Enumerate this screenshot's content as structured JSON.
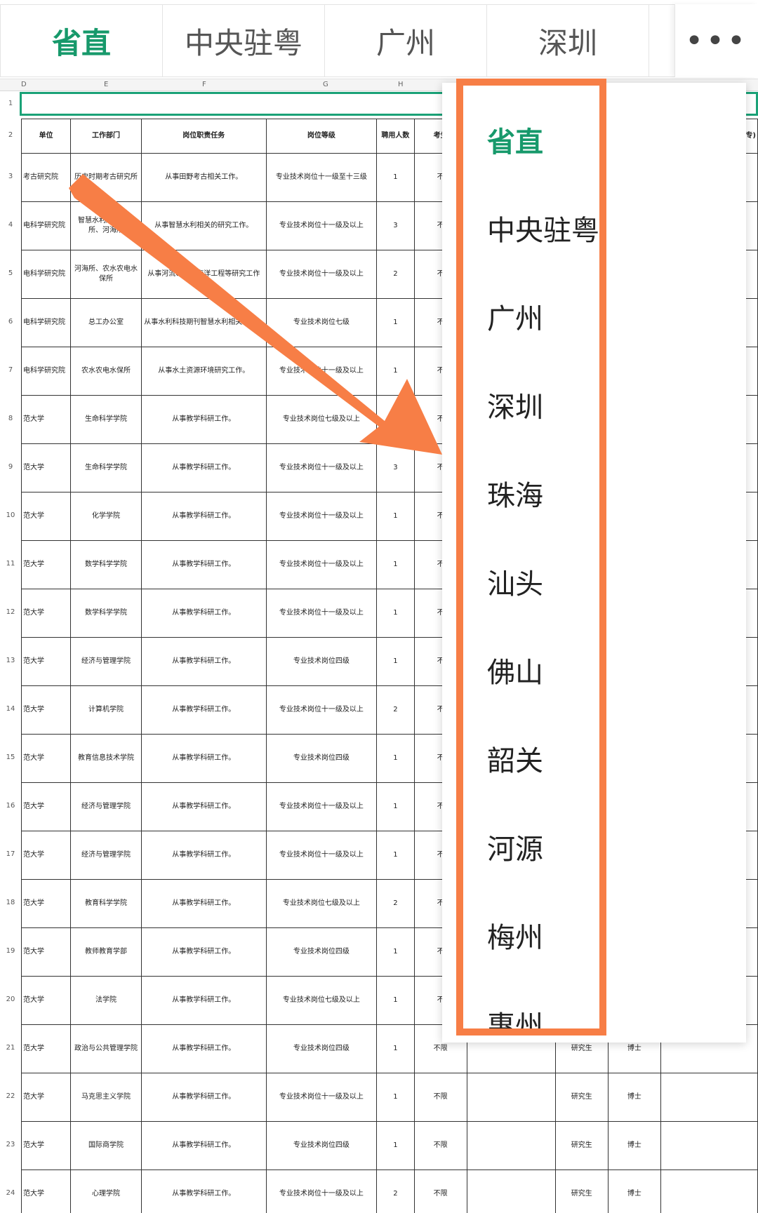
{
  "tabs": [
    {
      "label": "省直",
      "active": true
    },
    {
      "label": "中央驻粤",
      "active": false
    },
    {
      "label": "广州",
      "active": false
    },
    {
      "label": "深圳",
      "active": false
    }
  ],
  "more_label": "•••",
  "columns": [
    "D",
    "E",
    "F",
    "G",
    "H"
  ],
  "header_row": {
    "num": "2",
    "cells": [
      "单位",
      "工作部门",
      "岗位职责任务",
      "岗位等级",
      "聘用人数",
      "考生"
    ]
  },
  "row1_num": "1",
  "rows": [
    {
      "num": "3",
      "unit": "考古研究院",
      "dept": "历史时期考古研究所",
      "duty": "从事田野考古相关工作。",
      "level": "专业技术岗位十一级至十三级",
      "count": "1",
      "c6": "不",
      "c8": "",
      "c9": ""
    },
    {
      "num": "4",
      "unit": "电科学研究院",
      "dept": "智慧水利所、河海所、河海所",
      "duty": "从事智慧水利相关的研究工作。",
      "level": "专业技术岗位十一级及以上",
      "count": "3",
      "c6": "不",
      "c8": "",
      "c9": ""
    },
    {
      "num": "5",
      "unit": "电科学研究院",
      "dept": "河海所、农水农电水保所",
      "duty": "从事河流、近岸海洋工程等研究工作",
      "level": "专业技术岗位十一级及以上",
      "count": "2",
      "c6": "不",
      "c8": "",
      "c9": ""
    },
    {
      "num": "6",
      "unit": "电科学研究院",
      "dept": "总工办公室",
      "duty": "从事水利科技期刊智慧水利相关工作。",
      "level": "专业技术岗位七级",
      "count": "1",
      "c6": "不",
      "c8": "",
      "c9": ""
    },
    {
      "num": "7",
      "unit": "电科学研究院",
      "dept": "农水农电水保所",
      "duty": "从事水土资源环境研究工作。",
      "level": "专业技术岗位十一级及以上",
      "count": "1",
      "c6": "不",
      "c8": "",
      "c9": ""
    },
    {
      "num": "8",
      "unit": "范大学",
      "dept": "生命科学学院",
      "duty": "从事教学科研工作。",
      "level": "专业技术岗位七级及以上",
      "count": "",
      "c6": "不",
      "c8": "",
      "c9": ""
    },
    {
      "num": "9",
      "unit": "范大学",
      "dept": "生命科学学院",
      "duty": "从事教学科研工作。",
      "level": "专业技术岗位十一级及以上",
      "count": "3",
      "c6": "不",
      "c8": "",
      "c9": ""
    },
    {
      "num": "10",
      "unit": "范大学",
      "dept": "化学学院",
      "duty": "从事教学科研工作。",
      "level": "专业技术岗位十一级及以上",
      "count": "1",
      "c6": "不",
      "c8": "",
      "c9": ""
    },
    {
      "num": "11",
      "unit": "范大学",
      "dept": "数学科学学院",
      "duty": "从事教学科研工作。",
      "level": "专业技术岗位十一级及以上",
      "count": "1",
      "c6": "不",
      "c8": "",
      "c9": ""
    },
    {
      "num": "12",
      "unit": "范大学",
      "dept": "数学科学学院",
      "duty": "从事教学科研工作。",
      "level": "专业技术岗位十一级及以上",
      "count": "1",
      "c6": "不",
      "c8": "",
      "c9": ""
    },
    {
      "num": "13",
      "unit": "范大学",
      "dept": "经济与管理学院",
      "duty": "从事教学科研工作。",
      "level": "专业技术岗位四级",
      "count": "1",
      "c6": "不",
      "c8": "",
      "c9": ""
    },
    {
      "num": "14",
      "unit": "范大学",
      "dept": "计算机学院",
      "duty": "从事教学科研工作。",
      "level": "专业技术岗位十一级及以上",
      "count": "2",
      "c6": "不",
      "c8": "",
      "c9": ""
    },
    {
      "num": "15",
      "unit": "范大学",
      "dept": "教育信息技术学院",
      "duty": "从事教学科研工作。",
      "level": "专业技术岗位四级",
      "count": "1",
      "c6": "不",
      "c8": "",
      "c9": ""
    },
    {
      "num": "16",
      "unit": "范大学",
      "dept": "经济与管理学院",
      "duty": "从事教学科研工作。",
      "level": "专业技术岗位十一级及以上",
      "count": "1",
      "c6": "不",
      "c8": "",
      "c9": ""
    },
    {
      "num": "17",
      "unit": "范大学",
      "dept": "经济与管理学院",
      "duty": "从事教学科研工作。",
      "level": "专业技术岗位十一级及以上",
      "count": "1",
      "c6": "不",
      "c8": "",
      "c9": ""
    },
    {
      "num": "18",
      "unit": "范大学",
      "dept": "教育科学学院",
      "duty": "从事教学科研工作。",
      "level": "专业技术岗位七级及以上",
      "count": "2",
      "c6": "不",
      "c8": "",
      "c9": ""
    },
    {
      "num": "19",
      "unit": "范大学",
      "dept": "教师教育学部",
      "duty": "从事教学科研工作。",
      "level": "专业技术岗位四级",
      "count": "1",
      "c6": "不",
      "c8": "",
      "c9": ""
    },
    {
      "num": "20",
      "unit": "范大学",
      "dept": "法学院",
      "duty": "从事教学科研工作。",
      "level": "专业技术岗位七级及以上",
      "count": "1",
      "c6": "不",
      "c8": "",
      "c9": ""
    },
    {
      "num": "21",
      "unit": "范大学",
      "dept": "政治与公共管理学院",
      "duty": "从事教学科研工作。",
      "level": "专业技术岗位四级",
      "count": "1",
      "c6": "不限",
      "c8": "研究生",
      "c9": "博士"
    },
    {
      "num": "22",
      "unit": "范大学",
      "dept": "马克思主义学院",
      "duty": "从事教学科研工作。",
      "level": "专业技术岗位十一级及以上",
      "count": "1",
      "c6": "不限",
      "c8": "研究生",
      "c9": "博士"
    },
    {
      "num": "23",
      "unit": "范大学",
      "dept": "国际商学院",
      "duty": "从事教学科研工作。",
      "level": "专业技术岗位四级",
      "count": "1",
      "c6": "不限",
      "c8": "研究生",
      "c9": "博士"
    },
    {
      "num": "24",
      "unit": "范大学",
      "dept": "心理学院",
      "duty": "从事教学科研工作。",
      "level": "专业技术岗位十一级及以上",
      "count": "2",
      "c6": "不限",
      "c8": "研究生",
      "c9": "博士"
    }
  ],
  "right_edge_text": "专)",
  "dropdown_items": [
    {
      "label": "省直",
      "active": true
    },
    {
      "label": "中央驻粤",
      "active": false
    },
    {
      "label": "广州",
      "active": false
    },
    {
      "label": "深圳",
      "active": false
    },
    {
      "label": "珠海",
      "active": false
    },
    {
      "label": "汕头",
      "active": false
    },
    {
      "label": "佛山",
      "active": false
    },
    {
      "label": "韶关",
      "active": false
    },
    {
      "label": "河源",
      "active": false
    },
    {
      "label": "梅州",
      "active": false
    },
    {
      "label": "惠州",
      "active": false
    }
  ],
  "colors": {
    "accent": "#17996b",
    "highlight": "#f77e46"
  }
}
